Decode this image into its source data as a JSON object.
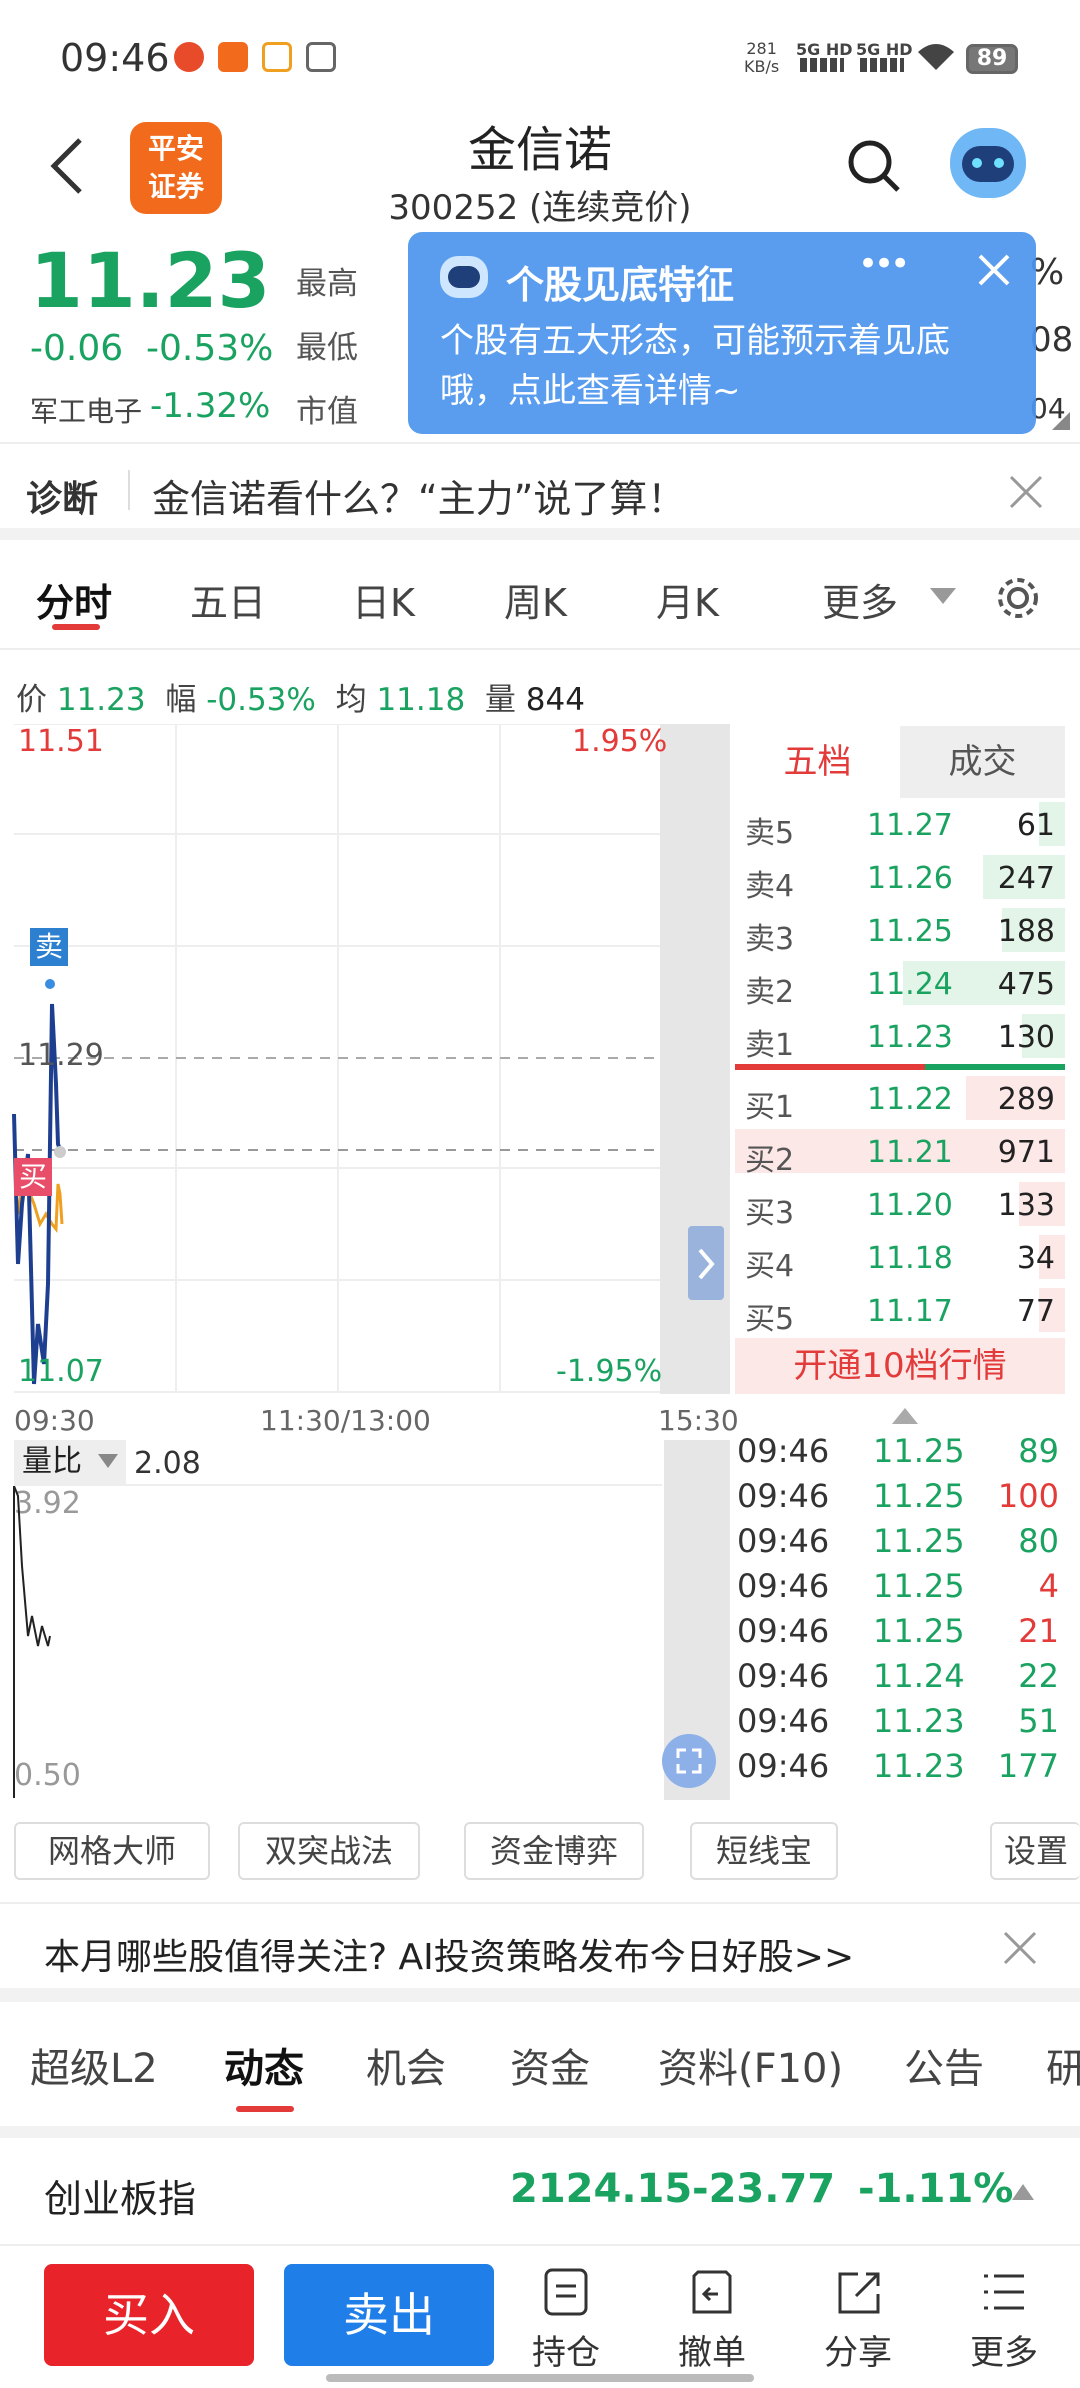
{
  "status_bar": {
    "time": "09:46",
    "net_speed": "281",
    "net_unit": "KB/s",
    "sig1": "5G HD",
    "sig2": "5G HD",
    "battery": "89"
  },
  "header": {
    "logo_line1": "平安",
    "logo_line2": "证券",
    "stock_name": "金信诺",
    "stock_code": "300252 (连续竞价)"
  },
  "quote": {
    "price": "11.23",
    "change": "-0.06",
    "change_pct": "-0.53%",
    "sector": "军工电子",
    "sector_pct": "-1.32%",
    "label_high": "最高",
    "label_low": "最低",
    "label_mktcap": "市值",
    "partial_right1": "%",
    "partial_right2": "08",
    "partial_right3": "04"
  },
  "popup": {
    "title": "个股见底特征",
    "body": "个股有五大形态，可能预示着见底哦，点此查看详情~",
    "more": "•••"
  },
  "diagnosis": {
    "label": "诊断",
    "text": "金信诺看什么？“主力”说了算！"
  },
  "chart_tabs": [
    "分时",
    "五日",
    "日K",
    "周K",
    "月K",
    "更多"
  ],
  "info_line": {
    "price_label": "价",
    "price": "11.23",
    "amp_label": "幅",
    "amp": "-0.53%",
    "avg_label": "均",
    "avg": "11.18",
    "vol_label": "量",
    "vol": "844"
  },
  "chart": {
    "y_max": "11.51",
    "y_max_pct": "1.95%",
    "y_mid": "11.29",
    "y_min": "11.07",
    "y_min_pct": "-1.95%",
    "x_start": "09:30",
    "x_mid": "11:30/13:00",
    "x_end": "15:30",
    "sell_marker": "卖",
    "buy_marker": "买",
    "line_color": "#1e3f8f",
    "avg_color": "#f0a020"
  },
  "volume_ratio": {
    "label": "量比",
    "value": "2.08",
    "y_max": "3.92",
    "y_min": "0.50"
  },
  "order_book": {
    "tab_active": "五档",
    "tab_other": "成交",
    "asks": [
      {
        "label": "卖5",
        "price": "11.27",
        "vol": "61",
        "fill": 0.06
      },
      {
        "label": "卖4",
        "price": "11.26",
        "vol": "247",
        "fill": 0.25
      },
      {
        "label": "卖3",
        "price": "11.25",
        "vol": "188",
        "fill": 0.19
      },
      {
        "label": "卖2",
        "price": "11.24",
        "vol": "475",
        "fill": 0.49
      },
      {
        "label": "卖1",
        "price": "11.23",
        "vol": "130",
        "fill": 0.13
      }
    ],
    "bids": [
      {
        "label": "买1",
        "price": "11.22",
        "vol": "289",
        "fill": 0.3
      },
      {
        "label": "买2",
        "price": "11.21",
        "vol": "971",
        "fill": 1.0
      },
      {
        "label": "买3",
        "price": "11.20",
        "vol": "133",
        "fill": 0.14
      },
      {
        "label": "买4",
        "price": "11.18",
        "vol": "34",
        "fill": 0.04
      },
      {
        "label": "买5",
        "price": "11.17",
        "vol": "77",
        "fill": 0.08
      }
    ],
    "upgrade": "开通10档行情"
  },
  "ticks": [
    {
      "time": "09:46",
      "price": "11.25",
      "vol": "89",
      "dir": "g"
    },
    {
      "time": "09:46",
      "price": "11.25",
      "vol": "100",
      "dir": "r"
    },
    {
      "time": "09:46",
      "price": "11.25",
      "vol": "80",
      "dir": "g"
    },
    {
      "time": "09:46",
      "price": "11.25",
      "vol": "4",
      "dir": "r"
    },
    {
      "time": "09:46",
      "price": "11.25",
      "vol": "21",
      "dir": "r"
    },
    {
      "time": "09:46",
      "price": "11.24",
      "vol": "22",
      "dir": "g"
    },
    {
      "time": "09:46",
      "price": "11.23",
      "vol": "51",
      "dir": "g"
    },
    {
      "time": "09:46",
      "price": "11.23",
      "vol": "177",
      "dir": "g"
    }
  ],
  "tools": [
    "网格大师",
    "双突战法",
    "资金博弈",
    "短线宝",
    "设置"
  ],
  "banner": "本月哪些股值得关注? AI投资策略发布今日好股>>",
  "info_tabs": [
    "超级L2",
    "动态",
    "机会",
    "资金",
    "资料(F10)",
    "公告",
    "研"
  ],
  "index": {
    "name": "创业板指",
    "value": "2124.15",
    "change": "-23.77",
    "pct": "-1.11%"
  },
  "bottom_bar": {
    "buy": "买入",
    "sell": "卖出",
    "hold": "持仓",
    "cancel": "撤单",
    "share": "分享",
    "more": "更多"
  }
}
